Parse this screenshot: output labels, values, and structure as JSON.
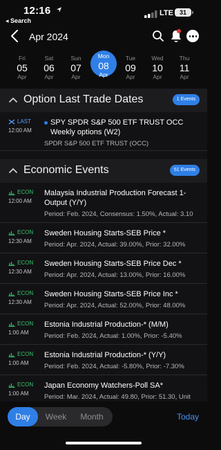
{
  "status": {
    "time": "12:16",
    "back_app": "◂ Search",
    "network": "LTE",
    "battery": "31"
  },
  "header": {
    "month": "Apr 2024"
  },
  "days": [
    {
      "name": "Fri",
      "date": "05",
      "month": "Apr"
    },
    {
      "name": "Sat",
      "date": "06",
      "month": "Apr"
    },
    {
      "name": "Sun",
      "date": "07",
      "month": "Apr"
    },
    {
      "name": "Mon",
      "date": "08",
      "month": "Apr",
      "selected": true
    },
    {
      "name": "Tue",
      "date": "09",
      "month": "Apr"
    },
    {
      "name": "Wed",
      "date": "10",
      "month": "Apr"
    },
    {
      "name": "Thu",
      "date": "11",
      "month": "Apr"
    }
  ],
  "sections": {
    "option": {
      "title": "Option Last Trade Dates",
      "count": "1 Events",
      "events": [
        {
          "tag": "LAST",
          "time": "12:00 AM",
          "name": "SPY SPDR S&P 500 ETF TRUST OCC Weekly options (W2)",
          "meta": "SPDR S&P 500 ETF TRUST (OCC)"
        }
      ]
    },
    "economic": {
      "title": "Economic Events",
      "count": "51 Events",
      "events": [
        {
          "tag": "ECON",
          "time": "12:00 AM",
          "name": "Malaysia Industrial Production Forecast 1-Output (Y/Y)",
          "meta": "Period: Feb. 2024, Consensus: 1.50%, Actual: 3.10"
        },
        {
          "tag": "ECON",
          "time": "12:30 AM",
          "name": "Sweden Housing Starts-SEB Price *",
          "meta": "Period: Apr. 2024, Actual: 39.00%, Prior: 32.00%"
        },
        {
          "tag": "ECON",
          "time": "12:30 AM",
          "name": "Sweden Housing Starts-SEB Price Dec *",
          "meta": "Period: Apr. 2024, Actual: 13.00%, Prior: 16.00%"
        },
        {
          "tag": "ECON",
          "time": "12:30 AM",
          "name": "Sweden Housing Starts-SEB Price Inc *",
          "meta": "Period: Apr. 2024, Actual: 52.00%, Prior: 48.00%"
        },
        {
          "tag": "ECON",
          "time": "1:00 AM",
          "name": "Estonia Industrial Production-* (M/M)",
          "meta": "Period: Feb. 2024, Actual: 1.00%, Prior: -5.40%"
        },
        {
          "tag": "ECON",
          "time": "1:00 AM",
          "name": "Estonia Industrial Production-* (Y/Y)",
          "meta": "Period: Feb. 2024, Actual: -5.80%, Prior: -7.30%"
        },
        {
          "tag": "ECON",
          "time": "1:00 AM",
          "name": "Japan Economy Watchers-Poll SA*",
          "meta": "Period: Mar. 2024, Actual: 49.80, Prior: 51.30, Unit"
        }
      ]
    }
  },
  "bottom": {
    "views": [
      "Day",
      "Week",
      "Month"
    ],
    "active_view": "Day",
    "today": "Today"
  },
  "colors": {
    "accent": "#2f7fe6",
    "econ": "#36c46b",
    "background": "#0c0c0d"
  }
}
